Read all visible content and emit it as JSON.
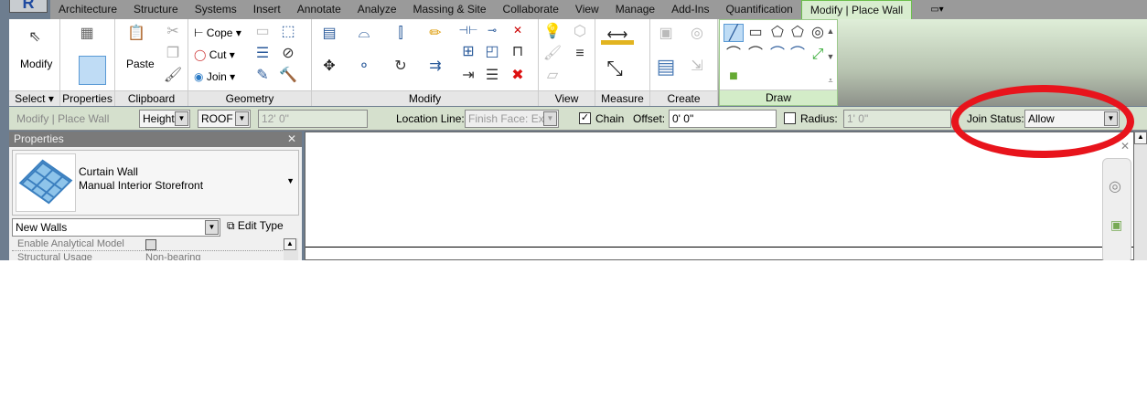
{
  "tabs": [
    "Architecture",
    "Structure",
    "Systems",
    "Insert",
    "Annotate",
    "Analyze",
    "Massing & Site",
    "Collaborate",
    "View",
    "Manage",
    "Add-Ins",
    "Quantification",
    "Modify | Place Wall"
  ],
  "active_tab": "Modify | Place Wall",
  "panels": {
    "select": {
      "label": "Select",
      "button": "Modify"
    },
    "properties": {
      "label": "Properties"
    },
    "clipboard": {
      "label": "Clipboard",
      "button": "Paste"
    },
    "geometry": {
      "label": "Geometry",
      "cope": "Cope",
      "cut": "Cut",
      "join": "Join"
    },
    "modify": {
      "label": "Modify"
    },
    "view": {
      "label": "View"
    },
    "measure": {
      "label": "Measure"
    },
    "create": {
      "label": "Create"
    },
    "draw": {
      "label": "Draw"
    }
  },
  "options_bar": {
    "context": "Modify | Place Wall",
    "height_mode": "Height:",
    "level": "ROOF",
    "height_value": "12'  0\"",
    "location_line_label": "Location Line:",
    "location_line_value": "Finish Face: Exte",
    "chain_label": "Chain",
    "chain_checked": true,
    "offset_label": "Offset:",
    "offset_value": "0'  0\"",
    "radius_label": "Radius:",
    "radius_checked": false,
    "radius_value": "1'  0\"",
    "join_status_label": "Join Status:",
    "join_status_value": "Allow"
  },
  "properties_panel": {
    "title": "Properties",
    "family": "Curtain Wall",
    "type": "Manual Interior Storefront",
    "filter": "New Walls",
    "edit_type": "Edit Type",
    "rows": [
      {
        "name": "Enable Analytical Model",
        "value": ""
      },
      {
        "name": "Structural Usage",
        "value": "Non-bearing"
      }
    ]
  },
  "colors": {
    "highlight": "#e8141c",
    "ribbon": "#dfeed8"
  }
}
